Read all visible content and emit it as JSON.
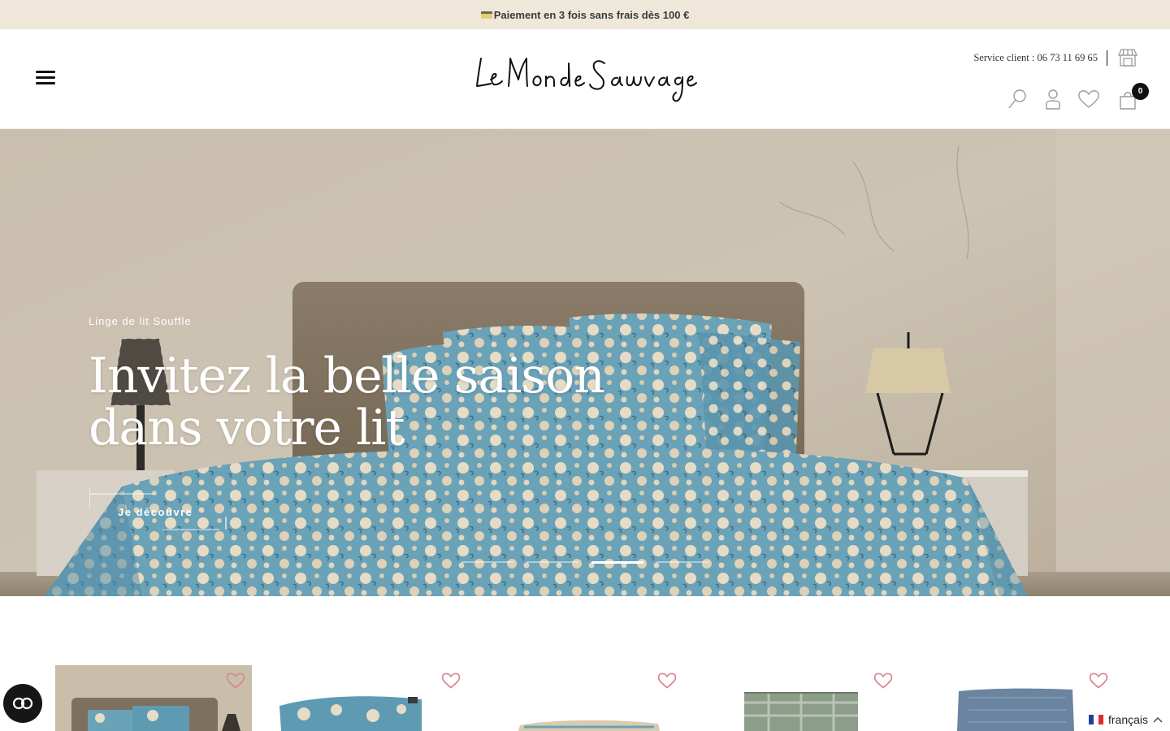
{
  "announcement": {
    "text": "Paiement en 3 fois sans frais dès 100 €",
    "icon": "credit-card-icon"
  },
  "header": {
    "logo_text": "Le Monde Sauvage",
    "service_client": "Service client : 06 73 11 69 65",
    "cart_count": "0",
    "icons": [
      "menu-icon",
      "store-icon",
      "search-icon",
      "account-icon",
      "wishlist-icon",
      "cart-icon"
    ]
  },
  "hero": {
    "eyebrow": "Linge de lit Souffle",
    "headline_line1": "Invitez la belle saison",
    "headline_line2": "dans votre lit",
    "cta": "Je découvre",
    "slides": 4,
    "active_slide": 3
  },
  "products": {
    "items": [
      {
        "image": "bedroom-bed-linen"
      },
      {
        "image": "floral-cushion"
      },
      {
        "image": "folded-floral-linen"
      },
      {
        "image": "green-checked-throw"
      },
      {
        "image": "blue-linen-throw"
      }
    ]
  },
  "accessibility": {
    "icon": "accessibility-toggle-icon"
  },
  "language": {
    "label": "français"
  },
  "colors": {
    "announcement_bg": "#efe7d9",
    "text_dark": "#111111",
    "heart_pink": "#d8868f",
    "floral_blue": "#5e9bb3",
    "hero_wall": "#c8bba9"
  }
}
